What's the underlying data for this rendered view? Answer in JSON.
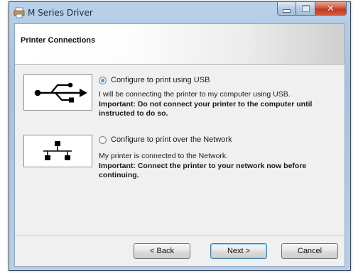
{
  "window": {
    "title": "M Series Driver"
  },
  "page": {
    "title": "Printer Connections"
  },
  "options": [
    {
      "label": "Configure to print using USB",
      "checked": true,
      "icon": "usb-icon",
      "description": "I will be connecting the printer to my computer using USB.",
      "important": "Important: Do not connect your printer to the computer until instructed to do so."
    },
    {
      "label": "Configure to print over the Network",
      "checked": false,
      "icon": "network-icon",
      "description": "My printer is connected to the Network.",
      "important": "Important: Connect the printer to your network now before continuing."
    }
  ],
  "buttons": {
    "back": "< Back",
    "next": "Next >",
    "cancel": "Cancel"
  }
}
